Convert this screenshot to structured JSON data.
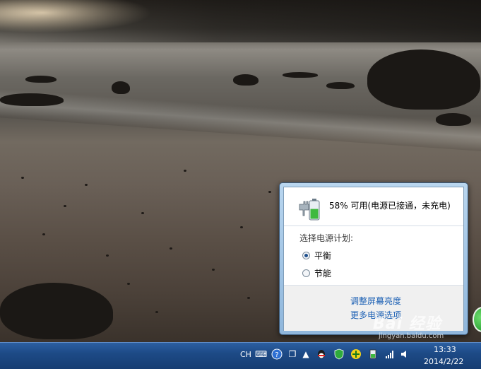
{
  "power_popup": {
    "battery_status": "58% 可用(电源已接通，未充电)",
    "battery_percent": 58,
    "plan_caption": "选择电源计划:",
    "plans": [
      {
        "label": "平衡",
        "selected": true
      },
      {
        "label": "节能",
        "selected": false
      }
    ],
    "links": {
      "adjust_brightness": "调整屏幕亮度",
      "more_power_options": "更多电源选项"
    }
  },
  "taskbar": {
    "input_language": "CH",
    "clock_time": "13:33",
    "clock_date": "2014/2/22",
    "icons": [
      "keyboard-icon",
      "help-icon",
      "window-restore-icon",
      "show-hidden-icons-arrow",
      "qq-icon",
      "shield-icon",
      "plus-app-icon",
      "power-icon",
      "network-icon",
      "volume-icon"
    ]
  },
  "watermark": {
    "brand": "Bai 经验",
    "url": "jingyan.baidu.com"
  },
  "colors": {
    "taskbar": "#1d4a86",
    "link": "#1a5fb4",
    "battery_fill": "#3fb93f"
  }
}
